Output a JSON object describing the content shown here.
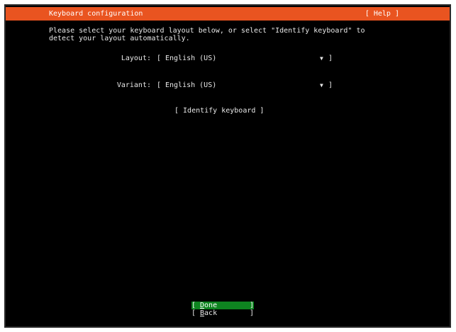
{
  "colors": {
    "header_bg": "#e95420",
    "screen_bg": "#000000",
    "focus_bg": "#0e8420",
    "text": "#e8e8e8"
  },
  "header": {
    "title": "Keyboard configuration",
    "help_label": "[ Help ]"
  },
  "intro": {
    "line1": "Please select your keyboard layout below, or select \"Identify keyboard\" to",
    "line2": "detect your layout automatically."
  },
  "fields": {
    "layout": {
      "label": "Layout:",
      "open_bracket": "[",
      "value": "English (US)",
      "arrow": "▼",
      "close_bracket": "]"
    },
    "variant": {
      "label": "Variant:",
      "open_bracket": "[",
      "value": "English (US)",
      "arrow": "▼",
      "close_bracket": "]"
    }
  },
  "identify_button": {
    "label": "[ Identify keyboard ]"
  },
  "buttons": {
    "done": {
      "open": "[",
      "hotkey": "D",
      "rest": "one",
      "close": "]"
    },
    "back": {
      "open": "[",
      "hotkey": "B",
      "rest": "ack",
      "close": "]"
    }
  }
}
